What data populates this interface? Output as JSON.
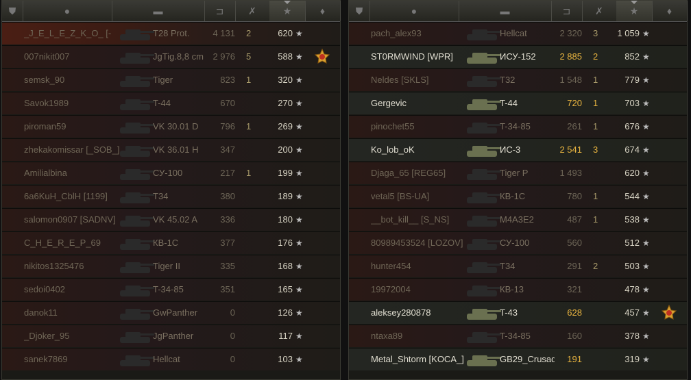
{
  "teams": [
    {
      "rows": [
        {
          "name": "_J_E_L_E_Z_K_O_ [-",
          "tank": "T28 Prot.",
          "damage": "4 131",
          "kills": "2",
          "score": "620",
          "alive": false,
          "medal": false
        },
        {
          "name": "007nikit007",
          "tank": "JgTig.8,8 cm",
          "damage": "2 976",
          "kills": "5",
          "score": "588",
          "alive": false,
          "medal": true
        },
        {
          "name": "semsk_90",
          "tank": "Tiger",
          "damage": "823",
          "kills": "1",
          "score": "320",
          "alive": false,
          "medal": false
        },
        {
          "name": "Savok1989",
          "tank": "T-44",
          "damage": "670",
          "kills": "",
          "score": "270",
          "alive": false,
          "medal": false
        },
        {
          "name": "piroman59",
          "tank": "VK 30.01 D",
          "damage": "796",
          "kills": "1",
          "score": "269",
          "alive": false,
          "medal": false
        },
        {
          "name": "zhekakomissar [_SOB_]",
          "tank": "VK 36.01 H",
          "damage": "347",
          "kills": "",
          "score": "200",
          "alive": false,
          "medal": false
        },
        {
          "name": "Amilialbina",
          "tank": "СУ-100",
          "damage": "217",
          "kills": "1",
          "score": "199",
          "alive": false,
          "medal": false
        },
        {
          "name": "6a6KuH_CblH [1199]",
          "tank": "T34",
          "damage": "380",
          "kills": "",
          "score": "189",
          "alive": false,
          "medal": false
        },
        {
          "name": "salomon0907 [SADNV]",
          "tank": "VK 45.02 A",
          "damage": "336",
          "kills": "",
          "score": "180",
          "alive": false,
          "medal": false
        },
        {
          "name": "C_H_E_R_E_P_69",
          "tank": "КВ-1С",
          "damage": "377",
          "kills": "",
          "score": "176",
          "alive": false,
          "medal": false
        },
        {
          "name": "nikitos1325476",
          "tank": "Tiger II",
          "damage": "335",
          "kills": "",
          "score": "168",
          "alive": false,
          "medal": false
        },
        {
          "name": "sedoi0402",
          "tank": "T-34-85",
          "damage": "351",
          "kills": "",
          "score": "165",
          "alive": false,
          "medal": false
        },
        {
          "name": "danok11",
          "tank": "GwPanther",
          "damage": "0",
          "kills": "",
          "score": "126",
          "alive": false,
          "medal": false
        },
        {
          "name": "_Djoker_95",
          "tank": "JgPanther",
          "damage": "0",
          "kills": "",
          "score": "117",
          "alive": false,
          "medal": false
        },
        {
          "name": "sanek7869",
          "tank": "Hellcat",
          "damage": "0",
          "kills": "",
          "score": "103",
          "alive": false,
          "medal": false
        }
      ]
    },
    {
      "rows": [
        {
          "name": "pach_alex93",
          "tank": "Hellcat",
          "damage": "2 320",
          "kills": "3",
          "score": "1 059",
          "alive": false,
          "medal": false
        },
        {
          "name": "ST0RMWIND [WPR]",
          "tank": "ИСУ-152",
          "damage": "2 885",
          "kills": "2",
          "score": "852",
          "alive": true,
          "medal": false
        },
        {
          "name": "Neldes [SKLS]",
          "tank": "T32",
          "damage": "1 548",
          "kills": "1",
          "score": "779",
          "alive": false,
          "medal": false
        },
        {
          "name": "Gergevic",
          "tank": "T-44",
          "damage": "720",
          "kills": "1",
          "score": "703",
          "alive": true,
          "medal": false
        },
        {
          "name": "pinochet55",
          "tank": "T-34-85",
          "damage": "261",
          "kills": "1",
          "score": "676",
          "alive": false,
          "medal": false
        },
        {
          "name": "Ko_lob_oK",
          "tank": "ИС-3",
          "damage": "2 541",
          "kills": "3",
          "score": "674",
          "alive": true,
          "medal": false
        },
        {
          "name": "Djaga_65 [REG65]",
          "tank": "Tiger P",
          "damage": "1 493",
          "kills": "",
          "score": "620",
          "alive": false,
          "medal": false
        },
        {
          "name": "vetal5 [BS-UA]",
          "tank": "КВ-1С",
          "damage": "780",
          "kills": "1",
          "score": "544",
          "alive": false,
          "medal": false
        },
        {
          "name": "__bot_kill__ [S_NS]",
          "tank": "M4A3E2",
          "damage": "487",
          "kills": "1",
          "score": "538",
          "alive": false,
          "medal": false
        },
        {
          "name": "80989453524 [LOZOV]",
          "tank": "СУ-100",
          "damage": "560",
          "kills": "",
          "score": "512",
          "alive": false,
          "medal": false
        },
        {
          "name": "hunter454",
          "tank": "T34",
          "damage": "291",
          "kills": "2",
          "score": "503",
          "alive": false,
          "medal": false
        },
        {
          "name": "19972004",
          "tank": "КВ-13",
          "damage": "321",
          "kills": "",
          "score": "478",
          "alive": false,
          "medal": false
        },
        {
          "name": "aleksey280878",
          "tank": "T-43",
          "damage": "628",
          "kills": "",
          "score": "457",
          "alive": true,
          "medal": true
        },
        {
          "name": "ntaxa89",
          "tank": "T-34-85",
          "damage": "160",
          "kills": "",
          "score": "378",
          "alive": false,
          "medal": false
        },
        {
          "name": "Metal_Shtorm [KOCA_]",
          "tank": "GB29_Crusad",
          "damage": "191",
          "kills": "",
          "score": "319",
          "alive": true,
          "medal": false
        }
      ]
    }
  ],
  "icons": {
    "star": "★",
    "header": [
      "shield-icon",
      "player-icon",
      "tank-icon",
      "gun-icon",
      "destroyed-icon",
      "star-icon",
      "medal-icon"
    ]
  }
}
